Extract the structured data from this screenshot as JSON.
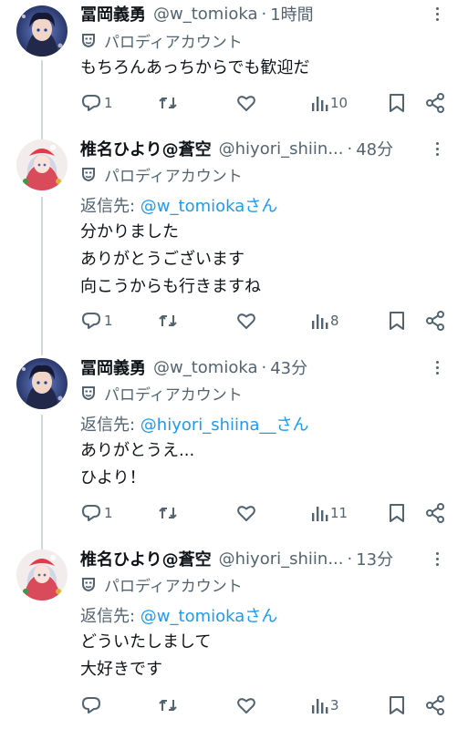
{
  "posts": [
    {
      "name": "冨岡義勇",
      "handle": "@w_tomioka",
      "dot": "·",
      "time": "1時間",
      "label": "パロディアカウント",
      "reply_prefix": "",
      "reply_mention": "",
      "reply_suffix": "",
      "lines": [
        "もちろんあっちからでも歓迎だ"
      ],
      "reply_count": "1",
      "repost_count": "",
      "like_count": "",
      "view_count": "10"
    },
    {
      "name": "椎名ひより@蒼空",
      "handle": "@hiyori_shiin...",
      "dot": "·",
      "time": "48分",
      "label": "パロディアカウント",
      "reply_prefix": "返信先: ",
      "reply_mention": "@w_tomioka",
      "reply_suffix": "さん",
      "lines": [
        "分かりました",
        "ありがとうございます",
        "向こうからも行きますね"
      ],
      "reply_count": "1",
      "repost_count": "",
      "like_count": "",
      "view_count": "8"
    },
    {
      "name": "冨岡義勇",
      "handle": "@w_tomioka",
      "dot": "·",
      "time": "43分",
      "label": "パロディアカウント",
      "reply_prefix": "返信先: ",
      "reply_mention": "@hiyori_shiina__",
      "reply_suffix": "さん",
      "lines": [
        "ありがとうえ...",
        "ひより！"
      ],
      "reply_count": "1",
      "repost_count": "",
      "like_count": "",
      "view_count": "11"
    },
    {
      "name": "椎名ひより@蒼空",
      "handle": "@hiyori_shiin...",
      "dot": "·",
      "time": "13分",
      "label": "パロディアカウント",
      "reply_prefix": "返信先: ",
      "reply_mention": "@w_tomioka",
      "reply_suffix": "さん",
      "lines": [
        "どういたしまして",
        "大好きです"
      ],
      "reply_count": "",
      "repost_count": "",
      "like_count": "",
      "view_count": "3"
    }
  ],
  "icons": {
    "parody": "parody-mask-icon",
    "reply": "reply-bubble-icon",
    "repost": "repost-arrows-icon",
    "like": "heart-icon",
    "views": "views-bars-icon",
    "bookmark": "bookmark-icon",
    "share": "share-icon",
    "more": "more-dots-icon"
  },
  "colors": {
    "text": "#0f1419",
    "muted": "#536471",
    "link": "#1d9bf0",
    "thread_line": "#cfd9de"
  }
}
